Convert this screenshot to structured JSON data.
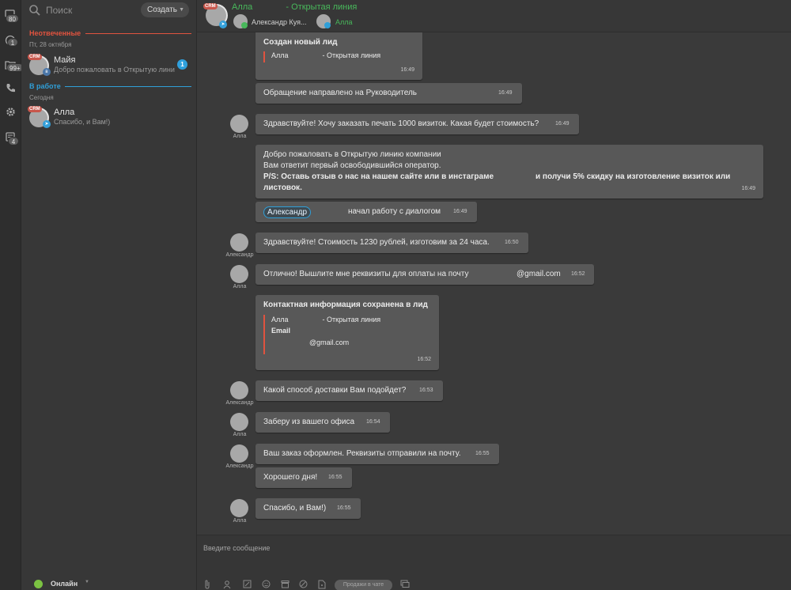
{
  "rail": {
    "items": [
      {
        "icon": "chat-icon",
        "badge": "80"
      },
      {
        "icon": "openlines-icon",
        "badge": "1"
      },
      {
        "icon": "crm-folder-icon",
        "badge": "99+"
      },
      {
        "icon": "phone-icon",
        "badge": ""
      },
      {
        "icon": "gear-icon",
        "badge": ""
      },
      {
        "icon": "notifications-icon",
        "badge": "4"
      }
    ]
  },
  "search": {
    "placeholder": "Поиск"
  },
  "create_button": {
    "label": "Создать"
  },
  "sections": {
    "unanswered": {
      "title": "Неотвеченные",
      "date": "Пт, 28 октября",
      "color": "#e0533f"
    },
    "in_work": {
      "title": "В работе",
      "date": "Сегодня",
      "color": "#2f9fd8"
    }
  },
  "chats": [
    {
      "crm": "CRM",
      "name": "Майя",
      "preview": "Добро пожаловать в Открытую линию компании",
      "unread": "1",
      "source_badge": "vk-icon"
    },
    {
      "crm": "CRM",
      "name": "Алла",
      "preview": "Спасибо, и Вам!)",
      "unread": "",
      "source_badge": "telegram-icon"
    }
  ],
  "status": {
    "label": "Онлайн"
  },
  "header": {
    "crm": "CRM",
    "title_name": "Алла",
    "title_suffix": "- Открытая линия",
    "member1": "Александр Куя...",
    "member2": "Алла"
  },
  "messages": {
    "m1": {
      "title": "Создан новый лид",
      "quote_name": "Алла",
      "quote_suffix": "- Открытая линия",
      "time": "16:49"
    },
    "m2": {
      "text": "Обращение направлено на Руководитель",
      "time": "16:49"
    },
    "m3": {
      "sender": "Алла",
      "text": "Здравствуйте! Хочу заказать печать 1000 визиток. Какая будет стоимость?",
      "time": "16:49"
    },
    "m4": {
      "line1": "Добро пожаловать в Открытую линию компании",
      "line2": "Вам ответит первый освободившийся оператор.",
      "line3a": "P/S: Оставь отзыв о нас на нашем сайте или в инстаграме",
      "line3b": "и получи 5% скидку на изготовление визиток или",
      "line4": "листовок.",
      "time": "16:49"
    },
    "m5": {
      "mention": "Александр",
      "text": "начал работу с диалогом",
      "time": "16:49"
    },
    "m6": {
      "sender": "Александр",
      "text": "Здравствуйте! Стоимость 1230 рублей, изготовим за 24 часа.",
      "time": "16:50"
    },
    "m7": {
      "sender": "Алла",
      "text": "Отлично! Вышлите мне реквизиты для оплаты на почту",
      "email_tail": "@gmail.com",
      "time": "16:52"
    },
    "m8": {
      "title": "Контактная информация сохранена в лид",
      "quote_name": "Алла",
      "quote_suffix": "- Открытая линия",
      "field_label": "Email",
      "field_value": "@gmail.com",
      "time": "16:52"
    },
    "m9": {
      "sender": "Александр",
      "text": "Какой способ доставки Вам подойдет?",
      "time": "16:53"
    },
    "m10": {
      "sender": "Алла",
      "text": "Заберу из вашего офиса",
      "time": "16:54"
    },
    "m11": {
      "sender": "Александр",
      "text": "Ваш заказ оформлен. Реквизиты отправили на почту.",
      "time": "16:55"
    },
    "m12": {
      "text": "Хорошего дня!",
      "time": "16:55"
    },
    "m13": {
      "sender": "Алла",
      "text": "Спасибо, и Вам!)",
      "time": "16:55"
    }
  },
  "composer": {
    "placeholder": "Введите сообщение",
    "sell_button": "Продажи в чате",
    "tools": [
      "attach-icon",
      "user-icon",
      "edit-icon",
      "smile-icon",
      "form-icon",
      "hide-icon",
      "document-icon",
      "copy-icon"
    ]
  }
}
